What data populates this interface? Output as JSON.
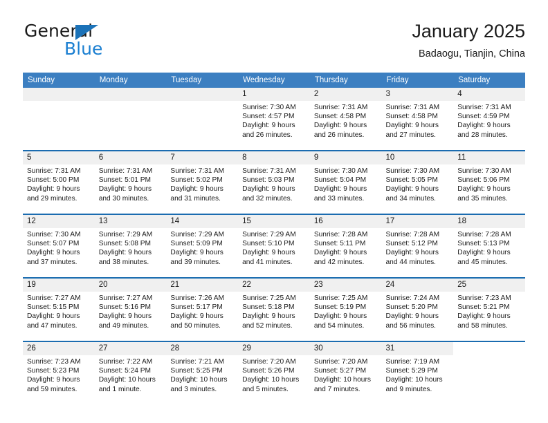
{
  "brand": {
    "word_one": "General",
    "word_two": "Blue",
    "triangle_icon": "brand-triangle-icon",
    "accent_color": "#1b72b8",
    "blue_text_color": "#1b7fd1"
  },
  "header": {
    "title": "January 2025",
    "subtitle": "Badaogu, Tianjin, China"
  },
  "theme": {
    "header_row_bg": "#3c7fc1",
    "row_divider": "#1b6cb0",
    "daynum_bg": "#f0f0f0",
    "text": "#1a1a1a"
  },
  "weekdays": [
    "Sunday",
    "Monday",
    "Tuesday",
    "Wednesday",
    "Thursday",
    "Friday",
    "Saturday"
  ],
  "weeks": [
    [
      {
        "day": "",
        "empty": true
      },
      {
        "day": "",
        "empty": true
      },
      {
        "day": "",
        "empty": true
      },
      {
        "day": "1",
        "sunrise": "Sunrise: 7:30 AM",
        "sunset": "Sunset: 4:57 PM",
        "daylight": "Daylight: 9 hours and 26 minutes."
      },
      {
        "day": "2",
        "sunrise": "Sunrise: 7:31 AM",
        "sunset": "Sunset: 4:58 PM",
        "daylight": "Daylight: 9 hours and 26 minutes."
      },
      {
        "day": "3",
        "sunrise": "Sunrise: 7:31 AM",
        "sunset": "Sunset: 4:58 PM",
        "daylight": "Daylight: 9 hours and 27 minutes."
      },
      {
        "day": "4",
        "sunrise": "Sunrise: 7:31 AM",
        "sunset": "Sunset: 4:59 PM",
        "daylight": "Daylight: 9 hours and 28 minutes."
      }
    ],
    [
      {
        "day": "5",
        "sunrise": "Sunrise: 7:31 AM",
        "sunset": "Sunset: 5:00 PM",
        "daylight": "Daylight: 9 hours and 29 minutes."
      },
      {
        "day": "6",
        "sunrise": "Sunrise: 7:31 AM",
        "sunset": "Sunset: 5:01 PM",
        "daylight": "Daylight: 9 hours and 30 minutes."
      },
      {
        "day": "7",
        "sunrise": "Sunrise: 7:31 AM",
        "sunset": "Sunset: 5:02 PM",
        "daylight": "Daylight: 9 hours and 31 minutes."
      },
      {
        "day": "8",
        "sunrise": "Sunrise: 7:31 AM",
        "sunset": "Sunset: 5:03 PM",
        "daylight": "Daylight: 9 hours and 32 minutes."
      },
      {
        "day": "9",
        "sunrise": "Sunrise: 7:30 AM",
        "sunset": "Sunset: 5:04 PM",
        "daylight": "Daylight: 9 hours and 33 minutes."
      },
      {
        "day": "10",
        "sunrise": "Sunrise: 7:30 AM",
        "sunset": "Sunset: 5:05 PM",
        "daylight": "Daylight: 9 hours and 34 minutes."
      },
      {
        "day": "11",
        "sunrise": "Sunrise: 7:30 AM",
        "sunset": "Sunset: 5:06 PM",
        "daylight": "Daylight: 9 hours and 35 minutes."
      }
    ],
    [
      {
        "day": "12",
        "sunrise": "Sunrise: 7:30 AM",
        "sunset": "Sunset: 5:07 PM",
        "daylight": "Daylight: 9 hours and 37 minutes."
      },
      {
        "day": "13",
        "sunrise": "Sunrise: 7:29 AM",
        "sunset": "Sunset: 5:08 PM",
        "daylight": "Daylight: 9 hours and 38 minutes."
      },
      {
        "day": "14",
        "sunrise": "Sunrise: 7:29 AM",
        "sunset": "Sunset: 5:09 PM",
        "daylight": "Daylight: 9 hours and 39 minutes."
      },
      {
        "day": "15",
        "sunrise": "Sunrise: 7:29 AM",
        "sunset": "Sunset: 5:10 PM",
        "daylight": "Daylight: 9 hours and 41 minutes."
      },
      {
        "day": "16",
        "sunrise": "Sunrise: 7:28 AM",
        "sunset": "Sunset: 5:11 PM",
        "daylight": "Daylight: 9 hours and 42 minutes."
      },
      {
        "day": "17",
        "sunrise": "Sunrise: 7:28 AM",
        "sunset": "Sunset: 5:12 PM",
        "daylight": "Daylight: 9 hours and 44 minutes."
      },
      {
        "day": "18",
        "sunrise": "Sunrise: 7:28 AM",
        "sunset": "Sunset: 5:13 PM",
        "daylight": "Daylight: 9 hours and 45 minutes."
      }
    ],
    [
      {
        "day": "19",
        "sunrise": "Sunrise: 7:27 AM",
        "sunset": "Sunset: 5:15 PM",
        "daylight": "Daylight: 9 hours and 47 minutes."
      },
      {
        "day": "20",
        "sunrise": "Sunrise: 7:27 AM",
        "sunset": "Sunset: 5:16 PM",
        "daylight": "Daylight: 9 hours and 49 minutes."
      },
      {
        "day": "21",
        "sunrise": "Sunrise: 7:26 AM",
        "sunset": "Sunset: 5:17 PM",
        "daylight": "Daylight: 9 hours and 50 minutes."
      },
      {
        "day": "22",
        "sunrise": "Sunrise: 7:25 AM",
        "sunset": "Sunset: 5:18 PM",
        "daylight": "Daylight: 9 hours and 52 minutes."
      },
      {
        "day": "23",
        "sunrise": "Sunrise: 7:25 AM",
        "sunset": "Sunset: 5:19 PM",
        "daylight": "Daylight: 9 hours and 54 minutes."
      },
      {
        "day": "24",
        "sunrise": "Sunrise: 7:24 AM",
        "sunset": "Sunset: 5:20 PM",
        "daylight": "Daylight: 9 hours and 56 minutes."
      },
      {
        "day": "25",
        "sunrise": "Sunrise: 7:23 AM",
        "sunset": "Sunset: 5:21 PM",
        "daylight": "Daylight: 9 hours and 58 minutes."
      }
    ],
    [
      {
        "day": "26",
        "sunrise": "Sunrise: 7:23 AM",
        "sunset": "Sunset: 5:23 PM",
        "daylight": "Daylight: 9 hours and 59 minutes."
      },
      {
        "day": "27",
        "sunrise": "Sunrise: 7:22 AM",
        "sunset": "Sunset: 5:24 PM",
        "daylight": "Daylight: 10 hours and 1 minute."
      },
      {
        "day": "28",
        "sunrise": "Sunrise: 7:21 AM",
        "sunset": "Sunset: 5:25 PM",
        "daylight": "Daylight: 10 hours and 3 minutes."
      },
      {
        "day": "29",
        "sunrise": "Sunrise: 7:20 AM",
        "sunset": "Sunset: 5:26 PM",
        "daylight": "Daylight: 10 hours and 5 minutes."
      },
      {
        "day": "30",
        "sunrise": "Sunrise: 7:20 AM",
        "sunset": "Sunset: 5:27 PM",
        "daylight": "Daylight: 10 hours and 7 minutes."
      },
      {
        "day": "31",
        "sunrise": "Sunrise: 7:19 AM",
        "sunset": "Sunset: 5:29 PM",
        "daylight": "Daylight: 10 hours and 9 minutes."
      },
      {
        "day": "",
        "empty": true,
        "blank": true
      }
    ]
  ]
}
